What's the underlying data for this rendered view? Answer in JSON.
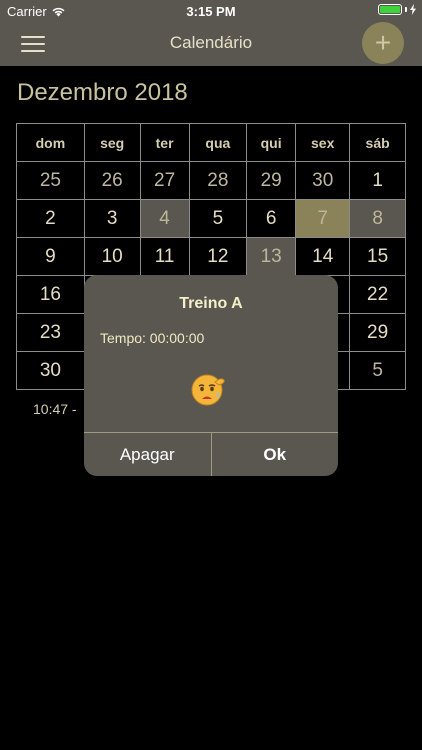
{
  "status_bar": {
    "carrier": "Carrier",
    "time": "3:15 PM",
    "battery_level": 1.0
  },
  "nav_bar": {
    "title": "Calendário",
    "menu_icon": "hamburger-menu-icon",
    "add_label": "+"
  },
  "calendar": {
    "month_title": "Dezembro 2018",
    "weekdays": [
      "dom",
      "seg",
      "ter",
      "qua",
      "qui",
      "sex",
      "sáb"
    ],
    "rows": [
      [
        "25",
        "26",
        "27",
        "28",
        "29",
        "30",
        "1"
      ],
      [
        "2",
        "3",
        "4",
        "5",
        "6",
        "7",
        "8"
      ],
      [
        "9",
        "10",
        "11",
        "12",
        "13",
        "14",
        "15"
      ],
      [
        "16",
        "",
        "",
        "",
        "",
        "",
        "22"
      ],
      [
        "23",
        "",
        "",
        "",
        "",
        "",
        "29"
      ],
      [
        "30",
        "",
        "",
        "",
        "",
        "",
        "5"
      ]
    ],
    "highlight_gray": [
      "4",
      "8",
      "13"
    ],
    "highlight_olive": [
      "7"
    ],
    "event_text": "10:47 -"
  },
  "dialog": {
    "title": "Treino A",
    "time_text": "Tempo: 00:00:00",
    "face_icon": "sad-face-icon",
    "delete_label": "Apagar",
    "ok_label": "Ok"
  },
  "colors": {
    "bar": "#59574f",
    "accent": "#8a8259",
    "text": "#d9d2b6",
    "battery": "#3ed33e"
  }
}
